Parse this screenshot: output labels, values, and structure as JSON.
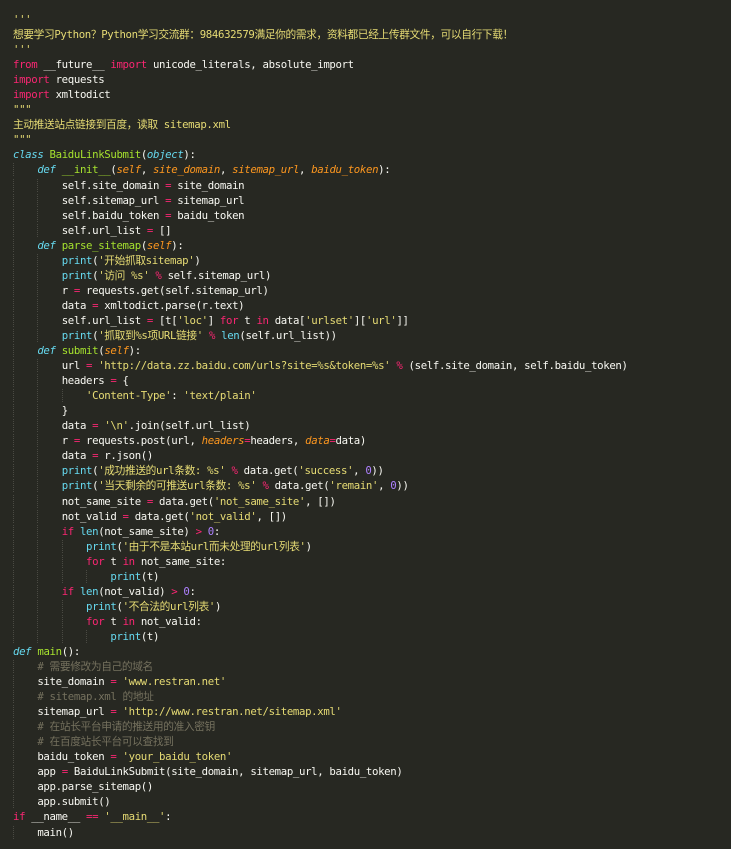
{
  "palette": {
    "default": "#f8f8f2",
    "keyword": "#f92672",
    "string": "#e6db74",
    "comment": "#75715e",
    "number": "#ae81ff",
    "def_name": "#a6e22e",
    "param": "#fd971f",
    "builtin": "#66d9ef",
    "background": "#272822"
  },
  "code_lines": [
    [
      [
        "string",
        "'''"
      ]
    ],
    [
      [
        "string",
        "想要学习Python？Python学习交流群：984632579满足你的需求，资料都已经上传群文件，可以自行下载！"
      ]
    ],
    [
      [
        "string",
        "'''"
      ]
    ],
    [
      [
        "keyword",
        "from"
      ],
      [
        "default",
        " __future__ "
      ],
      [
        "keyword",
        "import"
      ],
      [
        "default",
        " unicode_literals, absolute_import"
      ]
    ],
    [
      [
        "keyword",
        "import"
      ],
      [
        "default",
        " requests"
      ]
    ],
    [
      [
        "keyword",
        "import"
      ],
      [
        "default",
        " xmltodict"
      ]
    ],
    [
      [
        "string",
        "\"\"\""
      ]
    ],
    [
      [
        "string",
        "主动推送站点链接到百度，读取 sitemap.xml"
      ]
    ],
    [
      [
        "string",
        "\"\"\""
      ]
    ],
    [
      [
        "builtin_i",
        "class"
      ],
      [
        "default",
        " "
      ],
      [
        "def_name",
        "BaiduLinkSubmit"
      ],
      [
        "default",
        "("
      ],
      [
        "builtin_i",
        "object"
      ],
      [
        "default",
        "):"
      ]
    ],
    [
      [
        "indent",
        "    "
      ],
      [
        "builtin_i",
        "def"
      ],
      [
        "default",
        " "
      ],
      [
        "def_name",
        "__init__"
      ],
      [
        "default",
        "("
      ],
      [
        "param",
        "self"
      ],
      [
        "default",
        ", "
      ],
      [
        "param",
        "site_domain"
      ],
      [
        "default",
        ", "
      ],
      [
        "param",
        "sitemap_url"
      ],
      [
        "default",
        ", "
      ],
      [
        "param",
        "baidu_token"
      ],
      [
        "default",
        "):"
      ]
    ],
    [
      [
        "indent",
        "    "
      ],
      [
        "indent",
        "    "
      ],
      [
        "default",
        "self.site_domain "
      ],
      [
        "keyword",
        "="
      ],
      [
        "default",
        " site_domain"
      ]
    ],
    [
      [
        "indent",
        "    "
      ],
      [
        "indent",
        "    "
      ],
      [
        "default",
        "self.sitemap_url "
      ],
      [
        "keyword",
        "="
      ],
      [
        "default",
        " sitemap_url"
      ]
    ],
    [
      [
        "indent",
        "    "
      ],
      [
        "indent",
        "    "
      ],
      [
        "default",
        "self.baidu_token "
      ],
      [
        "keyword",
        "="
      ],
      [
        "default",
        " baidu_token"
      ]
    ],
    [
      [
        "indent",
        "    "
      ],
      [
        "indent",
        "    "
      ],
      [
        "default",
        "self.url_list "
      ],
      [
        "keyword",
        "="
      ],
      [
        "default",
        " []"
      ]
    ],
    [
      [
        "indent",
        "    "
      ],
      [
        "builtin_i",
        "def"
      ],
      [
        "default",
        " "
      ],
      [
        "def_name",
        "parse_sitemap"
      ],
      [
        "default",
        "("
      ],
      [
        "param",
        "self"
      ],
      [
        "default",
        "):"
      ]
    ],
    [
      [
        "indent",
        "    "
      ],
      [
        "indent",
        "    "
      ],
      [
        "builtin",
        "print"
      ],
      [
        "default",
        "("
      ],
      [
        "string",
        "'开始抓取sitemap'"
      ],
      [
        "default",
        ")"
      ]
    ],
    [
      [
        "indent",
        "    "
      ],
      [
        "indent",
        "    "
      ],
      [
        "builtin",
        "print"
      ],
      [
        "default",
        "("
      ],
      [
        "string",
        "'访问 %s'"
      ],
      [
        "default",
        " "
      ],
      [
        "keyword",
        "%"
      ],
      [
        "default",
        " self.sitemap_url)"
      ]
    ],
    [
      [
        "indent",
        "    "
      ],
      [
        "indent",
        "    "
      ],
      [
        "default",
        "r "
      ],
      [
        "keyword",
        "="
      ],
      [
        "default",
        " requests.get(self.sitemap_url)"
      ]
    ],
    [
      [
        "indent",
        "    "
      ],
      [
        "indent",
        "    "
      ],
      [
        "default",
        "data "
      ],
      [
        "keyword",
        "="
      ],
      [
        "default",
        " xmltodict.parse(r.text)"
      ]
    ],
    [
      [
        "indent",
        "    "
      ],
      [
        "indent",
        "    "
      ],
      [
        "default",
        "self.url_list "
      ],
      [
        "keyword",
        "="
      ],
      [
        "default",
        " [t["
      ],
      [
        "string",
        "'loc'"
      ],
      [
        "default",
        "] "
      ],
      [
        "keyword",
        "for"
      ],
      [
        "default",
        " t "
      ],
      [
        "keyword",
        "in"
      ],
      [
        "default",
        " data["
      ],
      [
        "string",
        "'urlset'"
      ],
      [
        "default",
        "]["
      ],
      [
        "string",
        "'url'"
      ],
      [
        "default",
        "]]"
      ]
    ],
    [
      [
        "indent",
        "    "
      ],
      [
        "indent",
        "    "
      ],
      [
        "builtin",
        "print"
      ],
      [
        "default",
        "("
      ],
      [
        "string",
        "'抓取到%s项URL链接'"
      ],
      [
        "default",
        " "
      ],
      [
        "keyword",
        "%"
      ],
      [
        "default",
        " "
      ],
      [
        "builtin",
        "len"
      ],
      [
        "default",
        "(self.url_list))"
      ]
    ],
    [
      [
        "indent",
        "    "
      ],
      [
        "builtin_i",
        "def"
      ],
      [
        "default",
        " "
      ],
      [
        "def_name",
        "submit"
      ],
      [
        "default",
        "("
      ],
      [
        "param",
        "self"
      ],
      [
        "default",
        "):"
      ]
    ],
    [
      [
        "indent",
        "    "
      ],
      [
        "indent",
        "    "
      ],
      [
        "default",
        "url "
      ],
      [
        "keyword",
        "="
      ],
      [
        "default",
        " "
      ],
      [
        "string",
        "'http://data.zz.baidu.com/urls?site=%s&token=%s'"
      ],
      [
        "default",
        " "
      ],
      [
        "keyword",
        "%"
      ],
      [
        "default",
        " (self.site_domain, self.baidu_token)"
      ]
    ],
    [
      [
        "indent",
        "    "
      ],
      [
        "indent",
        "    "
      ],
      [
        "default",
        "headers "
      ],
      [
        "keyword",
        "="
      ],
      [
        "default",
        " {"
      ]
    ],
    [
      [
        "indent",
        "    "
      ],
      [
        "indent",
        "    "
      ],
      [
        "indent",
        "    "
      ],
      [
        "string",
        "'Content-Type'"
      ],
      [
        "default",
        ": "
      ],
      [
        "string",
        "'text/plain'"
      ]
    ],
    [
      [
        "indent",
        "    "
      ],
      [
        "indent",
        "    "
      ],
      [
        "default",
        "}"
      ]
    ],
    [
      [
        "indent",
        "    "
      ],
      [
        "indent",
        "    "
      ],
      [
        "default",
        "data "
      ],
      [
        "keyword",
        "="
      ],
      [
        "default",
        " "
      ],
      [
        "string",
        "'\\n'"
      ],
      [
        "default",
        ".join(self.url_list)"
      ]
    ],
    [
      [
        "indent",
        "    "
      ],
      [
        "indent",
        "    "
      ],
      [
        "default",
        "r "
      ],
      [
        "keyword",
        "="
      ],
      [
        "default",
        " requests.post(url, "
      ],
      [
        "param",
        "headers"
      ],
      [
        "keyword",
        "="
      ],
      [
        "default",
        "headers, "
      ],
      [
        "param",
        "data"
      ],
      [
        "keyword",
        "="
      ],
      [
        "default",
        "data)"
      ]
    ],
    [
      [
        "indent",
        "    "
      ],
      [
        "indent",
        "    "
      ],
      [
        "default",
        "data "
      ],
      [
        "keyword",
        "="
      ],
      [
        "default",
        " r.json()"
      ]
    ],
    [
      [
        "indent",
        "    "
      ],
      [
        "indent",
        "    "
      ],
      [
        "builtin",
        "print"
      ],
      [
        "default",
        "("
      ],
      [
        "string",
        "'成功推送的url条数: %s'"
      ],
      [
        "default",
        " "
      ],
      [
        "keyword",
        "%"
      ],
      [
        "default",
        " data.get("
      ],
      [
        "string",
        "'success'"
      ],
      [
        "default",
        ", "
      ],
      [
        "number",
        "0"
      ],
      [
        "default",
        "))"
      ]
    ],
    [
      [
        "indent",
        "    "
      ],
      [
        "indent",
        "    "
      ],
      [
        "builtin",
        "print"
      ],
      [
        "default",
        "("
      ],
      [
        "string",
        "'当天剩余的可推送url条数: %s'"
      ],
      [
        "default",
        " "
      ],
      [
        "keyword",
        "%"
      ],
      [
        "default",
        " data.get("
      ],
      [
        "string",
        "'remain'"
      ],
      [
        "default",
        ", "
      ],
      [
        "number",
        "0"
      ],
      [
        "default",
        "))"
      ]
    ],
    [
      [
        "indent",
        "    "
      ],
      [
        "indent",
        "    "
      ],
      [
        "default",
        "not_same_site "
      ],
      [
        "keyword",
        "="
      ],
      [
        "default",
        " data.get("
      ],
      [
        "string",
        "'not_same_site'"
      ],
      [
        "default",
        ", [])"
      ]
    ],
    [
      [
        "indent",
        "    "
      ],
      [
        "indent",
        "    "
      ],
      [
        "default",
        "not_valid "
      ],
      [
        "keyword",
        "="
      ],
      [
        "default",
        " data.get("
      ],
      [
        "string",
        "'not_valid'"
      ],
      [
        "default",
        ", [])"
      ]
    ],
    [
      [
        "indent",
        "    "
      ],
      [
        "indent",
        "    "
      ],
      [
        "keyword",
        "if"
      ],
      [
        "default",
        " "
      ],
      [
        "builtin",
        "len"
      ],
      [
        "default",
        "(not_same_site) "
      ],
      [
        "keyword",
        ">"
      ],
      [
        "default",
        " "
      ],
      [
        "number",
        "0"
      ],
      [
        "default",
        ":"
      ]
    ],
    [
      [
        "indent",
        "    "
      ],
      [
        "indent",
        "    "
      ],
      [
        "indent",
        "    "
      ],
      [
        "builtin",
        "print"
      ],
      [
        "default",
        "("
      ],
      [
        "string",
        "'由于不是本站url而未处理的url列表'"
      ],
      [
        "default",
        ")"
      ]
    ],
    [
      [
        "indent",
        "    "
      ],
      [
        "indent",
        "    "
      ],
      [
        "indent",
        "    "
      ],
      [
        "keyword",
        "for"
      ],
      [
        "default",
        " t "
      ],
      [
        "keyword",
        "in"
      ],
      [
        "default",
        " not_same_site:"
      ]
    ],
    [
      [
        "indent",
        "    "
      ],
      [
        "indent",
        "    "
      ],
      [
        "indent",
        "    "
      ],
      [
        "indent",
        "    "
      ],
      [
        "builtin",
        "print"
      ],
      [
        "default",
        "(t)"
      ]
    ],
    [
      [
        "indent",
        "    "
      ],
      [
        "indent",
        "    "
      ],
      [
        "keyword",
        "if"
      ],
      [
        "default",
        " "
      ],
      [
        "builtin",
        "len"
      ],
      [
        "default",
        "(not_valid) "
      ],
      [
        "keyword",
        ">"
      ],
      [
        "default",
        " "
      ],
      [
        "number",
        "0"
      ],
      [
        "default",
        ":"
      ]
    ],
    [
      [
        "indent",
        "    "
      ],
      [
        "indent",
        "    "
      ],
      [
        "indent",
        "    "
      ],
      [
        "builtin",
        "print"
      ],
      [
        "default",
        "("
      ],
      [
        "string",
        "'不合法的url列表'"
      ],
      [
        "default",
        ")"
      ]
    ],
    [
      [
        "indent",
        "    "
      ],
      [
        "indent",
        "    "
      ],
      [
        "indent",
        "    "
      ],
      [
        "keyword",
        "for"
      ],
      [
        "default",
        " t "
      ],
      [
        "keyword",
        "in"
      ],
      [
        "default",
        " not_valid:"
      ]
    ],
    [
      [
        "indent",
        "    "
      ],
      [
        "indent",
        "    "
      ],
      [
        "indent",
        "    "
      ],
      [
        "indent",
        "    "
      ],
      [
        "builtin",
        "print"
      ],
      [
        "default",
        "(t)"
      ]
    ],
    [
      [
        "builtin_i",
        "def"
      ],
      [
        "default",
        " "
      ],
      [
        "def_name",
        "main"
      ],
      [
        "default",
        "():"
      ]
    ],
    [
      [
        "indent",
        "    "
      ],
      [
        "comment",
        "# 需要修改为自己的域名"
      ]
    ],
    [
      [
        "indent",
        "    "
      ],
      [
        "default",
        "site_domain "
      ],
      [
        "keyword",
        "="
      ],
      [
        "default",
        " "
      ],
      [
        "string",
        "'www.restran.net'"
      ]
    ],
    [
      [
        "indent",
        "    "
      ],
      [
        "comment",
        "# sitemap.xml 的地址"
      ]
    ],
    [
      [
        "indent",
        "    "
      ],
      [
        "default",
        "sitemap_url "
      ],
      [
        "keyword",
        "="
      ],
      [
        "default",
        " "
      ],
      [
        "string",
        "'http://www.restran.net/sitemap.xml'"
      ]
    ],
    [
      [
        "indent",
        "    "
      ],
      [
        "comment",
        "# 在站长平台申请的推送用的准入密钥"
      ]
    ],
    [
      [
        "indent",
        "    "
      ],
      [
        "comment",
        "# 在百度站长平台可以查找到"
      ]
    ],
    [
      [
        "indent",
        "    "
      ],
      [
        "default",
        "baidu_token "
      ],
      [
        "keyword",
        "="
      ],
      [
        "default",
        " "
      ],
      [
        "string",
        "'your_baidu_token'"
      ]
    ],
    [
      [
        "indent",
        "    "
      ],
      [
        "default",
        "app "
      ],
      [
        "keyword",
        "="
      ],
      [
        "default",
        " BaiduLinkSubmit(site_domain, sitemap_url, baidu_token)"
      ]
    ],
    [
      [
        "indent",
        "    "
      ],
      [
        "default",
        "app.parse_sitemap()"
      ]
    ],
    [
      [
        "indent",
        "    "
      ],
      [
        "default",
        "app.submit()"
      ]
    ],
    [
      [
        "keyword",
        "if"
      ],
      [
        "default",
        " __name__ "
      ],
      [
        "keyword",
        "=="
      ],
      [
        "default",
        " "
      ],
      [
        "string",
        "'__main__'"
      ],
      [
        "default",
        ":"
      ]
    ],
    [
      [
        "indent",
        "    "
      ],
      [
        "default",
        "main()"
      ]
    ]
  ]
}
